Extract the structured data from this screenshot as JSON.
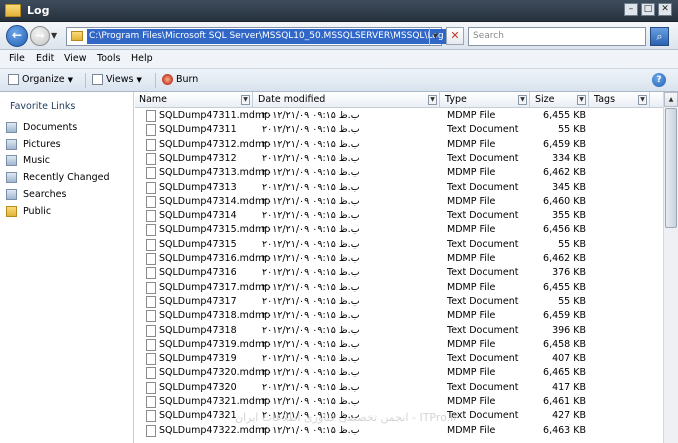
{
  "window": {
    "title": "Log"
  },
  "address": {
    "path": "C:\\Program Files\\Microsoft SQL Server\\MSSQL10_50.MSSQLSERVER\\MSSQL\\Log",
    "search_placeholder": "Search"
  },
  "menu": [
    "File",
    "Edit",
    "View",
    "Tools",
    "Help"
  ],
  "toolbar": {
    "organize": "Organize",
    "views": "Views",
    "burn": "Burn"
  },
  "nav": {
    "heading": "Favorite Links",
    "items": [
      {
        "label": "Documents",
        "icon": "documents-icon"
      },
      {
        "label": "Pictures",
        "icon": "pictures-icon"
      },
      {
        "label": "Music",
        "icon": "music-icon"
      },
      {
        "label": "Recently Changed",
        "icon": "recently-changed-icon"
      },
      {
        "label": "Searches",
        "icon": "searches-icon"
      },
      {
        "label": "Public",
        "icon": "folder-icon"
      }
    ]
  },
  "columns": [
    "Name",
    "Date modified",
    "Type",
    "Size",
    "Tags"
  ],
  "files": [
    {
      "name": "SQLDump47311.mdmp",
      "date": "۲۰۱۲/۲۱/۰۹ ب.ظ ۰۹:۱۵",
      "type": "MDMP File",
      "size": "6,455 KB"
    },
    {
      "name": "SQLDump47311",
      "date": "۲۰۱۲/۲۱/۰۹ ب.ظ ۰۹:۱۵",
      "type": "Text Document",
      "size": "55 KB"
    },
    {
      "name": "SQLDump47312.mdmp",
      "date": "۲۰۱۲/۲۱/۰۹ ب.ظ ۰۹:۱۵",
      "type": "MDMP File",
      "size": "6,459 KB"
    },
    {
      "name": "SQLDump47312",
      "date": "۲۰۱۲/۲۱/۰۹ ب.ظ ۰۹:۱۵",
      "type": "Text Document",
      "size": "334 KB"
    },
    {
      "name": "SQLDump47313.mdmp",
      "date": "۲۰۱۲/۲۱/۰۹ ب.ظ ۰۹:۱۵",
      "type": "MDMP File",
      "size": "6,462 KB"
    },
    {
      "name": "SQLDump47313",
      "date": "۲۰۱۲/۲۱/۰۹ ب.ظ ۰۹:۱۵",
      "type": "Text Document",
      "size": "345 KB"
    },
    {
      "name": "SQLDump47314.mdmp",
      "date": "۲۰۱۲/۲۱/۰۹ ب.ظ ۰۹:۱۵",
      "type": "MDMP File",
      "size": "6,460 KB"
    },
    {
      "name": "SQLDump47314",
      "date": "۲۰۱۲/۲۱/۰۹ ب.ظ ۰۹:۱۵",
      "type": "Text Document",
      "size": "355 KB"
    },
    {
      "name": "SQLDump47315.mdmp",
      "date": "۲۰۱۲/۲۱/۰۹ ب.ظ ۰۹:۱۵",
      "type": "MDMP File",
      "size": "6,456 KB"
    },
    {
      "name": "SQLDump47315",
      "date": "۲۰۱۲/۲۱/۰۹ ب.ظ ۰۹:۱۵",
      "type": "Text Document",
      "size": "55 KB"
    },
    {
      "name": "SQLDump47316.mdmp",
      "date": "۲۰۱۲/۲۱/۰۹ ب.ظ ۰۹:۱۵",
      "type": "MDMP File",
      "size": "6,462 KB"
    },
    {
      "name": "SQLDump47316",
      "date": "۲۰۱۲/۲۱/۰۹ ب.ظ ۰۹:۱۵",
      "type": "Text Document",
      "size": "376 KB"
    },
    {
      "name": "SQLDump47317.mdmp",
      "date": "۲۰۱۲/۲۱/۰۹ ب.ظ ۰۹:۱۵",
      "type": "MDMP File",
      "size": "6,455 KB"
    },
    {
      "name": "SQLDump47317",
      "date": "۲۰۱۲/۲۱/۰۹ ب.ظ ۰۹:۱۵",
      "type": "Text Document",
      "size": "55 KB"
    },
    {
      "name": "SQLDump47318.mdmp",
      "date": "۲۰۱۲/۲۱/۰۹ ب.ظ ۰۹:۱۵",
      "type": "MDMP File",
      "size": "6,459 KB"
    },
    {
      "name": "SQLDump47318",
      "date": "۲۰۱۲/۲۱/۰۹ ب.ظ ۰۹:۱۵",
      "type": "Text Document",
      "size": "396 KB"
    },
    {
      "name": "SQLDump47319.mdmp",
      "date": "۲۰۱۲/۲۱/۰۹ ب.ظ ۰۹:۱۵",
      "type": "MDMP File",
      "size": "6,458 KB"
    },
    {
      "name": "SQLDump47319",
      "date": "۲۰۱۲/۲۱/۰۹ ب.ظ ۰۹:۱۵",
      "type": "Text Document",
      "size": "407 KB"
    },
    {
      "name": "SQLDump47320.mdmp",
      "date": "۲۰۱۲/۲۱/۰۹ ب.ظ ۰۹:۱۵",
      "type": "MDMP File",
      "size": "6,465 KB"
    },
    {
      "name": "SQLDump47320",
      "date": "۲۰۱۲/۲۱/۰۹ ب.ظ ۰۹:۱۵",
      "type": "Text Document",
      "size": "417 KB"
    },
    {
      "name": "SQLDump47321.mdmp",
      "date": "۲۰۱۲/۲۱/۰۹ ب.ظ ۰۹:۱۵",
      "type": "MDMP File",
      "size": "6,461 KB"
    },
    {
      "name": "SQLDump47321",
      "date": "۲۰۱۲/۲۱/۰۹ ب.ظ ۰۹:۱۵",
      "type": "Text Document",
      "size": "427 KB"
    },
    {
      "name": "SQLDump47322.mdmp",
      "date": "۲۰۱۲/۲۱/۰۹ ب.ظ ۰۹:۱۵",
      "type": "MDMP File",
      "size": "6,463 KB"
    }
  ],
  "watermark": "ITPro.ir - انجمن تخصصی فناوری اطلاعات ایران"
}
